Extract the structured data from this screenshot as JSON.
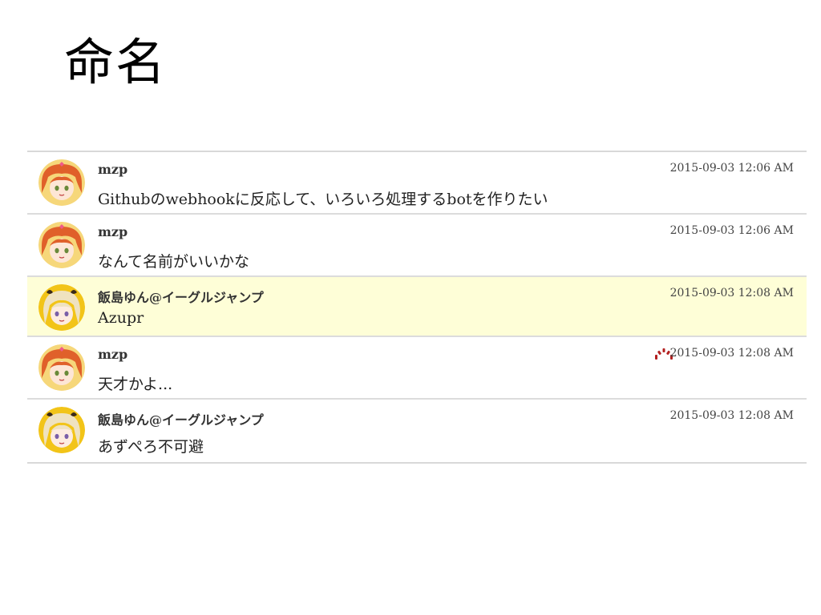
{
  "slide": {
    "title": "命名"
  },
  "messages": [
    {
      "user": "mzp",
      "text": "Githubのwebhookに反応して、いろいろ処理するbotを作りたい",
      "time": "2015-09-03 12:06 AM",
      "avatar": "orange-hair-avatar-icon"
    },
    {
      "user": "mzp",
      "text": "なんて名前がいいかな",
      "time": "2015-09-03 12:06 AM",
      "avatar": "orange-hair-avatar-icon"
    },
    {
      "user": "飯島ゆん@イーグルジャンプ",
      "text": "Azupr",
      "time": "2015-09-03 12:08 AM",
      "avatar": "blonde-hair-avatar-icon",
      "highlighted": true
    },
    {
      "user": "mzp",
      "text": "天才かよ...",
      "time": "2015-09-03 12:08 AM",
      "avatar": "orange-hair-avatar-icon",
      "status_icon": "loading-spinner-icon"
    },
    {
      "user": "飯島ゆん@イーグルジャンプ",
      "text": "あずぺろ不可避",
      "time": "2015-09-03 12:08 AM",
      "avatar": "blonde-hair-avatar-icon"
    }
  ],
  "colors": {
    "highlight_bg": "#fefed7",
    "divider": "#dcdcdc",
    "spinner": "#b32020"
  }
}
